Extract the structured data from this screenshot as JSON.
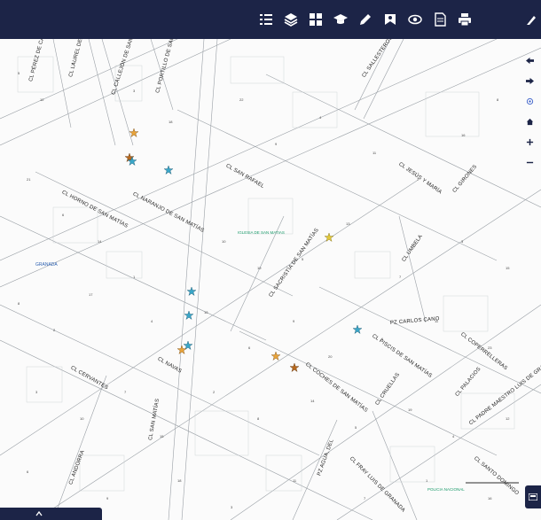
{
  "toolbar": {
    "items": [
      {
        "name": "legend-list-icon"
      },
      {
        "name": "layers-icon"
      },
      {
        "name": "grid-icon"
      },
      {
        "name": "graduation-cap-icon"
      },
      {
        "name": "pencil-icon"
      },
      {
        "name": "bookmark-icon"
      },
      {
        "name": "eye-icon"
      },
      {
        "name": "document-icon"
      },
      {
        "name": "printer-icon"
      },
      {
        "name": "profile-icon"
      }
    ]
  },
  "side_controls": [
    "arrow-left-icon",
    "arrow-right-icon",
    "locate-icon",
    "home-icon",
    "zoom-in-icon",
    "zoom-out-icon"
  ],
  "map": {
    "streets": [
      {
        "key": "s1",
        "text": "CL CALLEJÓN DE SAN MATÍAS"
      },
      {
        "key": "s2",
        "text": "CL PORTILLO DE SAN MATÍAS"
      },
      {
        "key": "s3",
        "text": "CL LAUREL DE SAN MATÍAS"
      },
      {
        "key": "s4",
        "text": "CL PÉREZ DE CASTRO"
      },
      {
        "key": "s5",
        "text": "CL SALLESTEROS"
      },
      {
        "key": "s6",
        "text": "CL SAN RAFAEL"
      },
      {
        "key": "s7",
        "text": "CL NARANJO DE SAN MATÍAS"
      },
      {
        "key": "s8",
        "text": "CL HORNO DE SAN MATÍAS"
      },
      {
        "key": "s9",
        "text": "CL JESÚS Y MARÍA"
      },
      {
        "key": "s10",
        "text": "CL GIRONES"
      },
      {
        "key": "s11",
        "text": "CL SACRISTÍA DE SAN MATÍAS"
      },
      {
        "key": "s12",
        "text": "CL UMBELA"
      },
      {
        "key": "s13",
        "text": "PZ CARLOS CANO"
      },
      {
        "key": "s14",
        "text": "CL PISCIS DE SAN MATÍAS"
      },
      {
        "key": "s15",
        "text": "CL COPERRELLERAS"
      },
      {
        "key": "s16",
        "text": "CL NAVAS"
      },
      {
        "key": "s17",
        "text": "CL CERVANTES"
      },
      {
        "key": "s18",
        "text": "CL COCHES DE SAN MATÍAS"
      },
      {
        "key": "s19",
        "text": "CL CRUELLAS"
      },
      {
        "key": "s20",
        "text": "CL PALACIOS"
      },
      {
        "key": "s21",
        "text": "CL PADRE MAESTRO LUIS DE GRANADA"
      },
      {
        "key": "s22",
        "text": "CL SANTO DOMINGO"
      },
      {
        "key": "s23",
        "text": "CL SAN MATÍAS"
      },
      {
        "key": "s24",
        "text": "PZ AGUA, DEL"
      },
      {
        "key": "s25",
        "text": "CL FRAY LUIS DE GRANADA"
      },
      {
        "key": "s26",
        "text": "CL ANDORRA"
      }
    ],
    "pois": [
      {
        "key": "iglesia",
        "text": "IGLESIA DE SAN MATIAS"
      },
      {
        "key": "policia",
        "text": "POLICIA NACIONAL"
      }
    ],
    "places": [
      {
        "key": "granada",
        "text": "GRANADA"
      }
    ]
  },
  "colors": {
    "toolbar_bg": "#1c2447",
    "star_orange": "#e8a33a",
    "star_blue": "#3aa7c9",
    "star_yellow": "#e3c93a",
    "star_brown": "#b86a1f"
  }
}
